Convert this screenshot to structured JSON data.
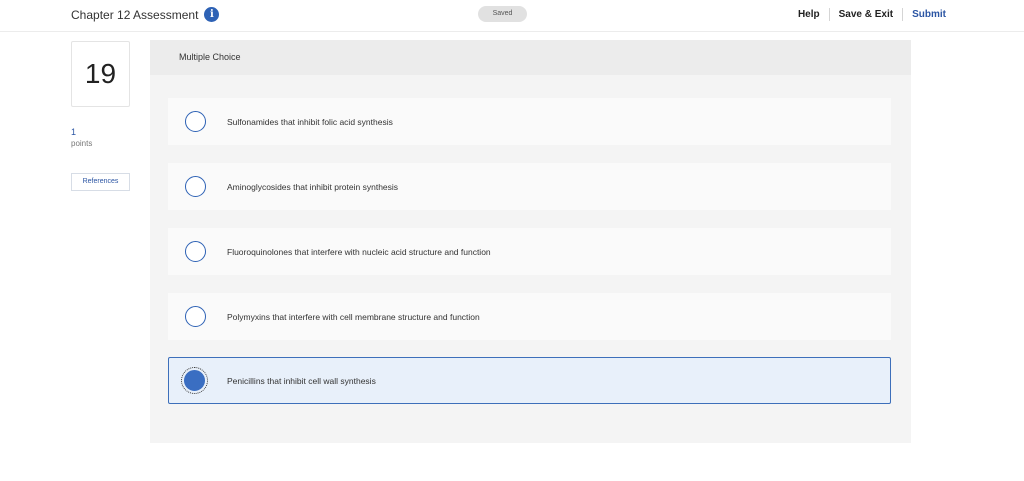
{
  "header": {
    "title": "Chapter 12 Assessment",
    "info_icon": "i",
    "saved_label": "Saved",
    "help_label": "Help",
    "save_exit_label": "Save & Exit",
    "submit_label": "Submit"
  },
  "sidebar": {
    "question_number": "19",
    "points_value": "1",
    "points_label": "points",
    "references_label": "References"
  },
  "question": {
    "type_label": "Multiple Choice",
    "selected_index": 4,
    "options": [
      "Sulfonamides that inhibit folic acid synthesis",
      "Aminoglycosides that inhibit protein synthesis",
      "Fluoroquinolones that interfere with nucleic acid structure and function",
      "Polymyxins that interfere with cell membrane structure and function",
      "Penicillins that inhibit cell wall synthesis"
    ]
  },
  "colors": {
    "accent": "#2b55a3",
    "radio_selected": "#3a6ec2",
    "selected_bg": "#e8f0fa"
  }
}
